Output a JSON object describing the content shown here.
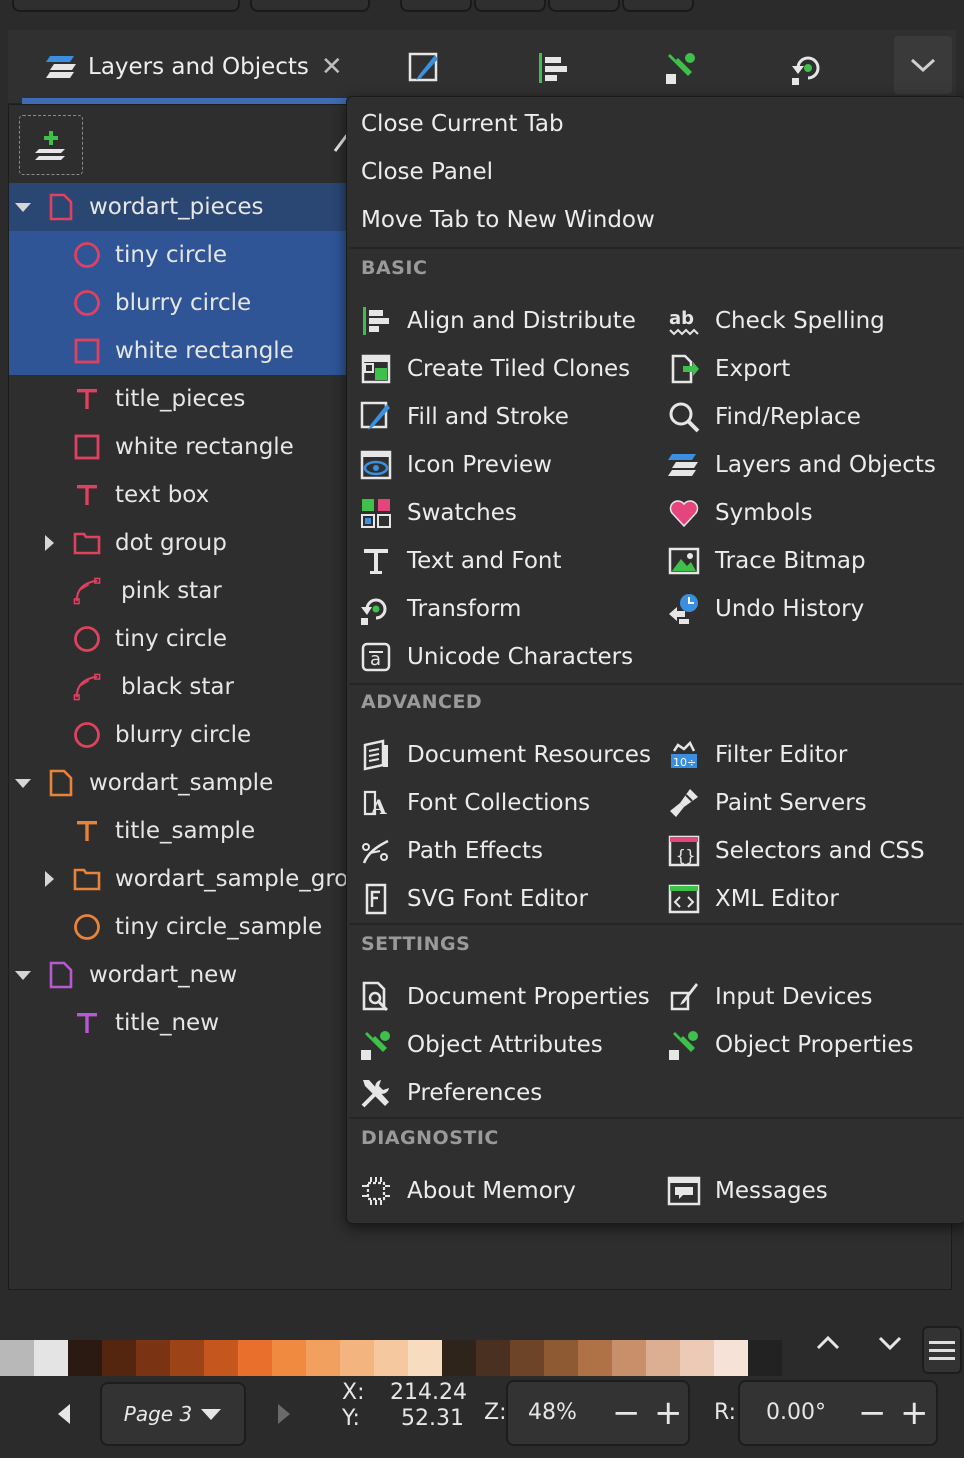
{
  "tabs": {
    "active_label": "Layers and Objects",
    "others": [
      "fill-and-stroke",
      "align-and-distribute",
      "object-properties",
      "transform"
    ]
  },
  "tree": [
    {
      "label": "wordart_pieces",
      "level": 0,
      "icon": "layer-icon",
      "color": "#e0415e",
      "expanded": true,
      "state": "parent-sel"
    },
    {
      "label": "tiny circle",
      "level": 1,
      "icon": "circle-icon",
      "color": "#e0415e",
      "state": "sel"
    },
    {
      "label": "blurry circle",
      "level": 1,
      "icon": "circle-icon",
      "color": "#e0415e",
      "state": "sel"
    },
    {
      "label": "white rectangle",
      "level": 1,
      "icon": "rect-icon",
      "color": "#e0415e",
      "state": "sel"
    },
    {
      "label": "title_pieces",
      "level": 1,
      "icon": "text-icon",
      "color": "#e0415e"
    },
    {
      "label": "white rectangle",
      "level": 1,
      "icon": "rect-icon",
      "color": "#e0415e"
    },
    {
      "label": "text box",
      "level": 1,
      "icon": "text-icon",
      "color": "#e0415e"
    },
    {
      "label": "dot group",
      "level": 1,
      "icon": "group-icon",
      "color": "#e0415e",
      "collapsed": true
    },
    {
      "label": "pink star",
      "level": 1,
      "icon": "path-icon",
      "color": "#e0415e"
    },
    {
      "label": "tiny circle",
      "level": 1,
      "icon": "circle-icon",
      "color": "#e0415e"
    },
    {
      "label": "black star",
      "level": 1,
      "icon": "path-icon",
      "color": "#e0415e"
    },
    {
      "label": "blurry circle",
      "level": 1,
      "icon": "circle-icon",
      "color": "#e0415e"
    },
    {
      "label": "wordart_sample",
      "level": 0,
      "icon": "layer-icon",
      "color": "#e8833a",
      "expanded": true
    },
    {
      "label": "title_sample",
      "level": 1,
      "icon": "text-icon",
      "color": "#e8833a"
    },
    {
      "label": "wordart_sample_group",
      "level": 1,
      "icon": "group-icon",
      "color": "#e8833a",
      "collapsed": true
    },
    {
      "label": "tiny circle_sample",
      "level": 1,
      "icon": "circle-icon",
      "color": "#e8833a"
    },
    {
      "label": "wordart_new",
      "level": 0,
      "icon": "layer-icon",
      "color": "#b65ad0",
      "expanded": true
    },
    {
      "label": "title_new",
      "level": 1,
      "icon": "text-icon",
      "color": "#b65ad0"
    }
  ],
  "menu": {
    "top_items": [
      "Close Current Tab",
      "Close Panel",
      "Move Tab to New Window"
    ],
    "sections": [
      {
        "heading": "BASIC",
        "items": [
          {
            "label": "Align and Distribute",
            "icon": "align-icon"
          },
          {
            "label": "Check Spelling",
            "icon": "spellcheck-icon"
          },
          {
            "label": "Create Tiled Clones",
            "icon": "tiled-clones-icon"
          },
          {
            "label": "Export",
            "icon": "export-icon"
          },
          {
            "label": "Fill and Stroke",
            "icon": "fill-stroke-icon"
          },
          {
            "label": "Find/Replace",
            "icon": "find-icon"
          },
          {
            "label": "Icon Preview",
            "icon": "icon-preview-icon"
          },
          {
            "label": "Layers and Objects",
            "icon": "layers-icon"
          },
          {
            "label": "Swatches",
            "icon": "swatches-icon"
          },
          {
            "label": "Symbols",
            "icon": "symbols-heart-icon"
          },
          {
            "label": "Text and Font",
            "icon": "text-font-icon"
          },
          {
            "label": "Trace Bitmap",
            "icon": "trace-bitmap-icon"
          },
          {
            "label": "Transform",
            "icon": "transform-icon"
          },
          {
            "label": "Undo History",
            "icon": "undo-history-icon"
          },
          {
            "label": "Unicode Characters",
            "icon": "unicode-icon"
          }
        ]
      },
      {
        "heading": "ADVANCED",
        "items": [
          {
            "label": "Document Resources",
            "icon": "doc-resources-icon"
          },
          {
            "label": "Filter Editor",
            "icon": "filter-editor-icon"
          },
          {
            "label": "Font Collections",
            "icon": "font-collections-icon"
          },
          {
            "label": "Paint Servers",
            "icon": "paint-servers-icon"
          },
          {
            "label": "Path Effects",
            "icon": "path-effects-icon"
          },
          {
            "label": "Selectors and CSS",
            "icon": "selectors-css-icon"
          },
          {
            "label": "SVG Font Editor",
            "icon": "svg-font-editor-icon"
          },
          {
            "label": "XML Editor",
            "icon": "xml-editor-icon"
          }
        ]
      },
      {
        "heading": "SETTINGS",
        "items": [
          {
            "label": "Document Properties",
            "icon": "doc-properties-icon"
          },
          {
            "label": "Input Devices",
            "icon": "input-devices-icon"
          },
          {
            "label": "Object Attributes",
            "icon": "object-attributes-icon"
          },
          {
            "label": "Object Properties",
            "icon": "object-properties-icon"
          },
          {
            "label": "Preferences",
            "icon": "preferences-icon"
          }
        ]
      },
      {
        "heading": "DIAGNOSTIC",
        "items": [
          {
            "label": "About Memory",
            "icon": "memory-icon"
          },
          {
            "label": "Messages",
            "icon": "messages-icon"
          }
        ]
      }
    ]
  },
  "palette": [
    "#b8b8b8",
    "#e4e4e4",
    "#2a1a12",
    "#55260f",
    "#7a3414",
    "#9c4418",
    "#c4561e",
    "#e8702c",
    "#f08a40",
    "#f2a060",
    "#f4b480",
    "#f6c8a0",
    "#f8dcc0",
    "#2e241c",
    "#4a3020",
    "#6e4428",
    "#8e5a34",
    "#ae7246",
    "#c8906a",
    "#dcae92",
    "#eccab6",
    "#f6e2d6",
    "#222222"
  ],
  "status": {
    "page": "Page 3",
    "x_label": "X:",
    "x_value": "214.24",
    "y_label": "Y:",
    "y_value": "52.31",
    "z_label": "Z:",
    "zoom": "48%",
    "r_label": "R:",
    "rotation": "0.00°"
  }
}
